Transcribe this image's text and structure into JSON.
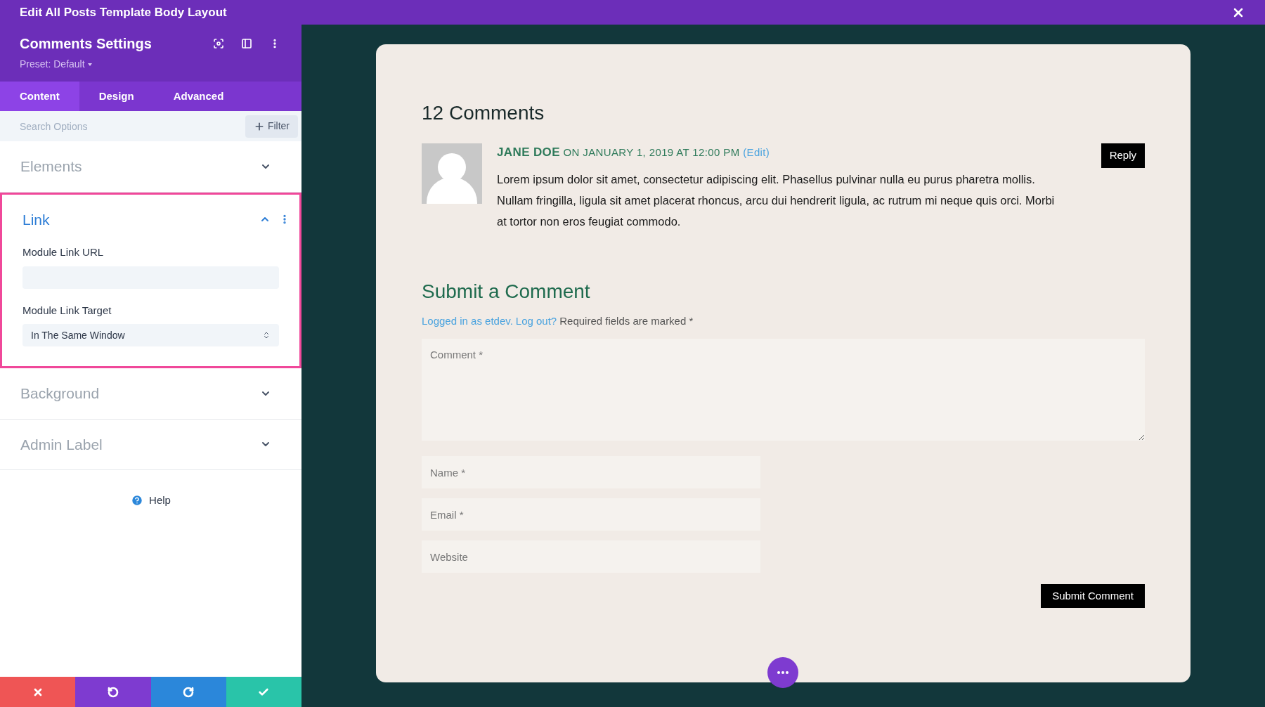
{
  "window": {
    "title": "Edit All Posts Template Body Layout"
  },
  "panel": {
    "title": "Comments Settings",
    "preset": "Preset: Default",
    "tabs": [
      {
        "label": "Content",
        "selected": true
      },
      {
        "label": "Design",
        "selected": false
      },
      {
        "label": "Advanced",
        "selected": false
      }
    ],
    "search": {
      "placeholder": "Search Options"
    },
    "filter_button": "Filter",
    "sections": [
      {
        "title": "Elements",
        "expanded": false,
        "highlighted": false
      },
      {
        "title": "Link",
        "expanded": true,
        "highlighted": true,
        "fields": [
          {
            "kind": "text",
            "label": "Module Link URL"
          },
          {
            "kind": "select",
            "label": "Module Link Target",
            "value": "In The Same Window"
          }
        ]
      },
      {
        "title": "Background",
        "expanded": false,
        "highlighted": false
      },
      {
        "title": "Admin Label",
        "expanded": false,
        "highlighted": false
      }
    ],
    "help": "Help",
    "footer_buttons": [
      {
        "kind": "discard"
      },
      {
        "kind": "undo"
      },
      {
        "kind": "redo"
      },
      {
        "kind": "save"
      }
    ]
  },
  "preview": {
    "comments_title": "12 Comments",
    "comment": {
      "author": "JANE DOE",
      "meta": "ON JANUARY 1, 2019 AT 12:00 PM",
      "edit": "(Edit)",
      "text": "Lorem ipsum dolor sit amet, consectetur adipiscing elit. Phasellus pulvinar nulla eu purus pharetra mollis. Nullam fringilla, ligula sit amet placerat rhoncus, arcu dui hendrerit ligula, ac rutrum mi neque quis orci. Morbi at tortor non eros feugiat commodo.",
      "reply": "Reply"
    },
    "form": {
      "title": "Submit a Comment",
      "logged_in": "Logged in as etdev.",
      "logout": "Log out?",
      "required_note": "Required fields are marked *",
      "fields": [
        {
          "kind": "textarea",
          "placeholder": "Comment *"
        },
        {
          "kind": "input",
          "placeholder": "Name *"
        },
        {
          "kind": "input",
          "placeholder": "Email *"
        },
        {
          "kind": "input",
          "placeholder": "Website"
        }
      ],
      "submit": "Submit Comment"
    }
  }
}
